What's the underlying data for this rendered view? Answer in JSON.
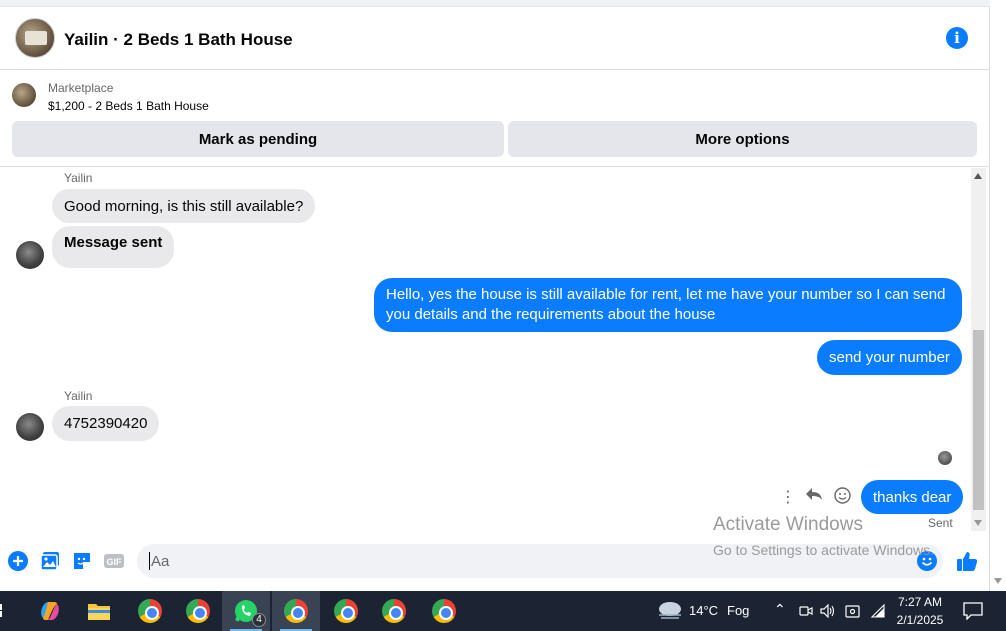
{
  "header": {
    "title": "Yailin · 2 Beds 1 Bath House"
  },
  "marketplace": {
    "label": "Marketplace",
    "listing": "$1,200 - 2 Beds 1 Bath House",
    "mark_pending_label": "Mark as pending",
    "more_options_label": "More options"
  },
  "messages": {
    "sender_name_1": "Yailin",
    "in_1": "Good morning, is this still available?",
    "in_2": "Message sent",
    "out_1": "Hello, yes the house is still available for rent, let me have your number so I can send you details and the requirements about the house",
    "out_2": "send your number",
    "sender_name_2": "Yailin",
    "in_3": "4752390420",
    "out_3": "thanks dear",
    "status": "Sent"
  },
  "composer": {
    "placeholder": "Aa"
  },
  "watermark": {
    "title": "Activate Windows",
    "subtitle": "Go to Settings to activate Windows."
  },
  "taskbar": {
    "weather_temp": "14°C",
    "weather_desc": "Fog",
    "time": "7:27 AM",
    "date": "2/1/2025",
    "whatsapp_badge": "4"
  },
  "colors": {
    "accent": "#0a7cff",
    "incoming_bubble": "#e9e9eb",
    "button_bg": "#e4e6eb",
    "taskbar_bg": "#1c2433"
  },
  "icons": [
    "info-icon",
    "add-icon",
    "image-icon",
    "sticker-icon",
    "gif-icon",
    "emoji-icon",
    "like-icon",
    "more-icon",
    "reply-icon",
    "react-icon",
    "chrome-icon",
    "whatsapp-icon",
    "folder-icon",
    "copilot-icon",
    "cloud-icon",
    "notification-icon"
  ]
}
